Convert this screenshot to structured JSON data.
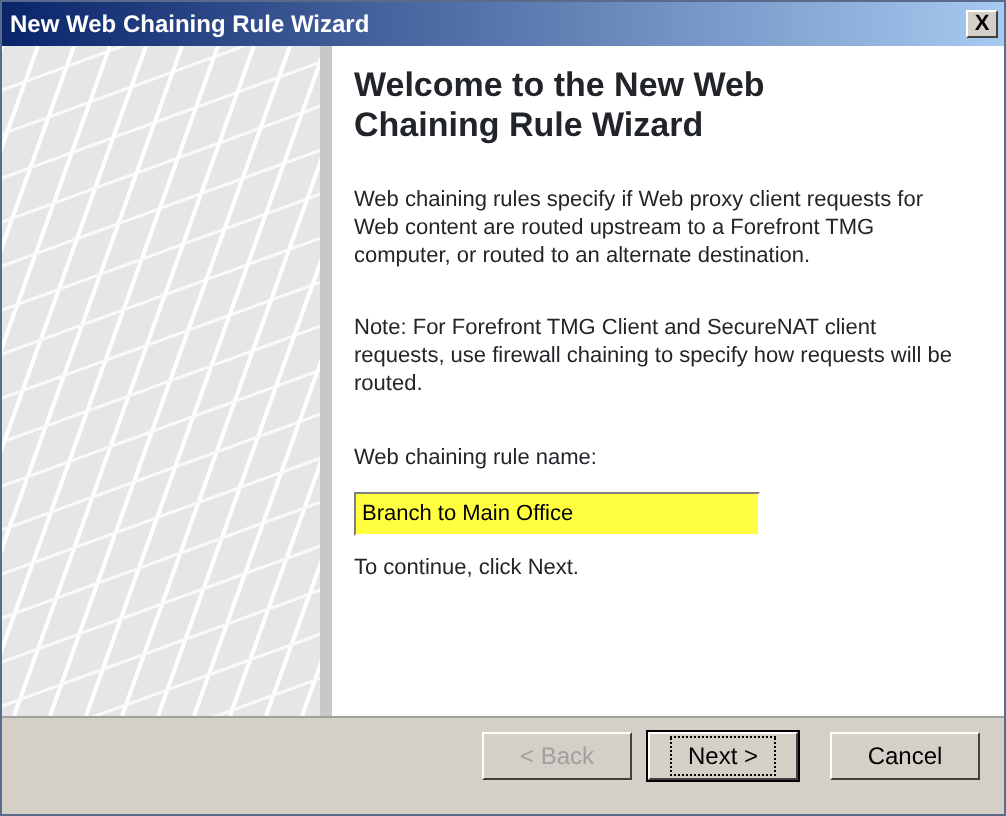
{
  "window": {
    "title": "New Web Chaining Rule Wizard",
    "close_label": "X"
  },
  "page": {
    "heading": "Welcome to the New Web Chaining Rule Wizard",
    "paragraphs": [
      "Web chaining rules specify if Web proxy client requests for Web content are routed upstream to a Forefront TMG computer, or routed to an alternate destination.",
      "Note: For Forefront TMG Client and SecureNAT client requests, use firewall chaining to specify how requests will be routed."
    ],
    "name_label": "Web chaining rule name:",
    "name_value": "Branch to Main Office",
    "hint": "To continue, click Next."
  },
  "buttons": [
    {
      "label": "< Back",
      "disabled": true,
      "default": false
    },
    {
      "label": "Next >",
      "disabled": false,
      "default": true
    },
    {
      "label": "Cancel",
      "disabled": false,
      "default": false
    }
  ]
}
